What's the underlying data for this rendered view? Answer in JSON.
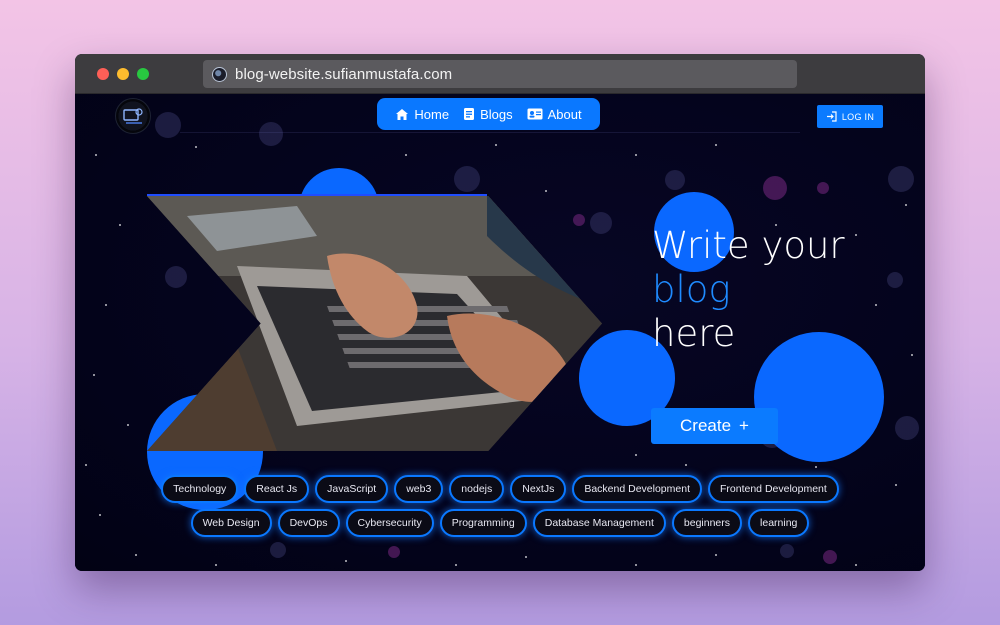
{
  "browser": {
    "url": "blog-website.sufianmustafa.com",
    "favicon": "site-logo-icon"
  },
  "header": {
    "logo": "site-logo",
    "nav": [
      {
        "label": "Home",
        "icon": "home-icon"
      },
      {
        "label": "Blogs",
        "icon": "document-icon"
      },
      {
        "label": "About",
        "icon": "contact-card-icon"
      }
    ],
    "login_label": "LOG IN",
    "login_icon": "login-icon"
  },
  "hero": {
    "line1": "Write your",
    "line2": "blog",
    "line3": "here",
    "create_label": "Create",
    "create_icon": "+",
    "image": "hands-typing-on-laptop"
  },
  "tags": [
    "Technology",
    "React Js",
    "JavaScript",
    "web3",
    "nodejs",
    "NextJs",
    "Backend Development",
    "Frontend Development",
    "Web Design",
    "DevOps",
    "Cybersecurity",
    "Programming",
    "Database Management",
    "beginners",
    "learning"
  ],
  "colors": {
    "accent": "#0a78ff",
    "background": "#03031a",
    "headline_accent": "#1f8bff"
  }
}
